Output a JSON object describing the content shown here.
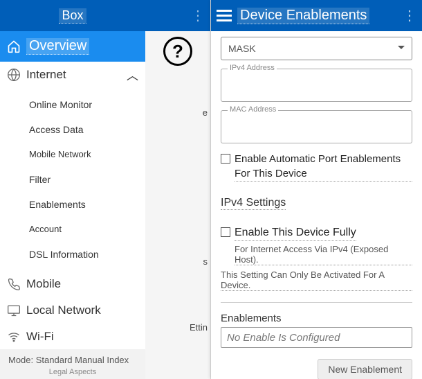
{
  "sidebar": {
    "brand": "Box",
    "overview": "Overview",
    "sections": {
      "internet": {
        "label": "Internet",
        "items": [
          "Online Monitor",
          "Access Data",
          "Mobile Network",
          "Filter",
          "Enablements",
          "Account",
          "DSL Information"
        ]
      },
      "mobile": "Mobile",
      "local": "Local Network",
      "wifi": "Wi-Fi"
    },
    "footer": {
      "mode": "Mode: Standard Manual Index",
      "legal": "Legal Aspects"
    }
  },
  "mid": {
    "help": "?",
    "text1": "e",
    "text2": "s",
    "text3": "Ettin"
  },
  "panel": {
    "title": "Device Enablements",
    "select_value": "MASK",
    "ipv4_label": "IPv4 Address",
    "mac_label": "MAC Address",
    "auto_port": "Enable Automatic Port Enablements For This Device",
    "ipv4_settings": "IPv4 Settings",
    "enable_full": "Enable This Device Fully",
    "enable_full_note": "For Internet Access Via IPv4 (Exposed Host).",
    "enable_full_note2": "This Setting Can Only Be Activated For A Device.",
    "enablements": "Enablements",
    "no_enable": "No Enable Is Configured",
    "new_btn": "New Enablement"
  }
}
